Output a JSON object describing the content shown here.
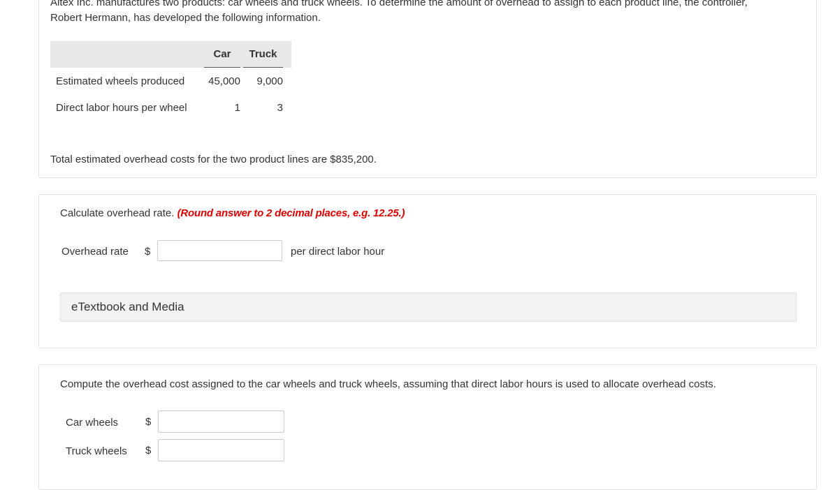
{
  "problem": {
    "intro_line1": "Altex Inc. manufactures two products: car wheels and truck wheels. To determine the amount of overhead to assign to each product line, the controller,",
    "intro_line2": "Robert Hermann, has developed the following information.",
    "table": {
      "columns": [
        "Car",
        "Truck"
      ],
      "rows": [
        {
          "label": "Estimated wheels produced",
          "car": "45,000",
          "truck": "9,000"
        },
        {
          "label": "Direct labor hours per wheel",
          "car": "1",
          "truck": "3"
        }
      ]
    },
    "total_text": "Total estimated overhead costs for the two product lines are $835,200."
  },
  "part1": {
    "instruction": "Calculate overhead rate.",
    "note": "(Round answer to 2 decimal places, e.g. 12.25.)",
    "field_label": "Overhead rate",
    "currency": "$",
    "value": "",
    "unit": "per direct labor hour",
    "etextbook": "eTextbook and Media"
  },
  "part2": {
    "instruction": "Compute the overhead cost assigned to the car wheels and truck wheels, assuming that direct labor hours is used to allocate overhead costs.",
    "fields": [
      {
        "label": "Car wheels",
        "currency": "$",
        "value": ""
      },
      {
        "label": "Truck wheels",
        "currency": "$",
        "value": ""
      }
    ]
  },
  "colors": {
    "accent_red": "#dd0000",
    "header_bg": "#e8e8e8",
    "panel_border": "#e1e1e1"
  }
}
